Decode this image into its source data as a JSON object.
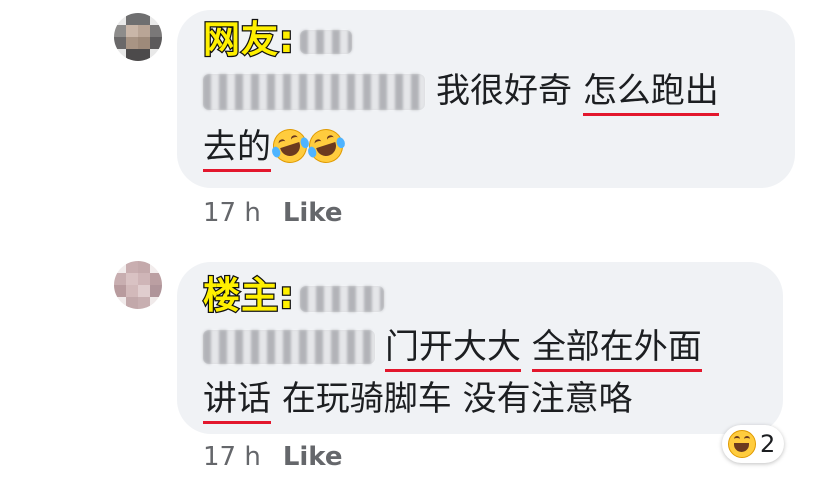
{
  "comments": [
    {
      "tag": "网友:",
      "segments": [
        "我很好奇 ",
        "怎么跑出",
        "去的"
      ],
      "time": "17 h",
      "like": "Like"
    },
    {
      "tag": "楼主:",
      "segments": [
        "门开大大",
        "全部在外面",
        "讲话",
        "在玩骑脚车 没有注意咯"
      ],
      "time": "17 h",
      "like": "Like",
      "reaction": {
        "icon": "laughing-emoji-icon",
        "count": "2"
      }
    }
  ],
  "colors": {
    "underline": "#e3172d",
    "tag_fill": "#fff000",
    "bubble": "#f0f2f5",
    "meta": "#65676b"
  }
}
